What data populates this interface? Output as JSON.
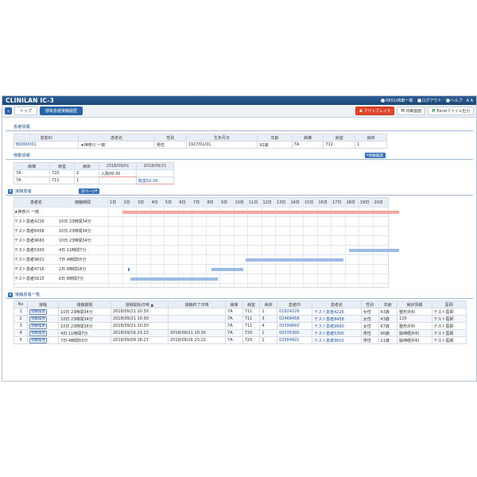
{
  "app": {
    "title": "CLINILAN IC-3"
  },
  "titlebar": {
    "items": [
      "0801/四郎一郎",
      "ログアウト",
      "ヘルプ",
      "A A"
    ]
  },
  "toolbar": {
    "crumbs": [
      "トップ",
      "感染患者接触履歴"
    ],
    "buttons": [
      "アウトブレイク",
      "印刷画面",
      "Excelファイル出力"
    ]
  },
  "patient": {
    "section": "患者情報",
    "headers": [
      "患者ID",
      "患者名",
      "性別",
      "生年月日",
      "年齢",
      "病棟",
      "病室",
      "病床"
    ],
    "row": [
      "B0000001",
      "★神奈川 一郎",
      "男性",
      "1927/01/01",
      "91歳",
      "7A",
      "711",
      "1"
    ]
  },
  "move": {
    "section": "移動情報",
    "button": "移動履歴",
    "headers": [
      "病棟",
      "病室",
      "病床",
      "2018/09/01",
      "2018/09/21"
    ],
    "rows": [
      [
        "7A",
        "720",
        "2",
        "入院09:30",
        ""
      ],
      [
        "7A",
        "711",
        "1",
        "",
        "転室10:30"
      ]
    ]
  },
  "contact": {
    "section": "接触患者",
    "page_btn": "次ページ",
    "headers": [
      "患者名",
      "接触時間"
    ],
    "days": [
      "1日",
      "2日",
      "3日",
      "4日",
      "5日",
      "6日",
      "7日",
      "8日",
      "9日",
      "10日",
      "11日",
      "12日",
      "13日",
      "14日",
      "15日",
      "16日",
      "17日",
      "18日",
      "19日",
      "20日"
    ],
    "rows": [
      {
        "name": "★神奈川 一郎",
        "dur": "",
        "start": 1,
        "end": 20.9,
        "color": "#f2a9a0"
      },
      {
        "name": "テスト患者4226",
        "dur": "10日 23時間34分",
        "start": 0,
        "end": 0,
        "color": ""
      },
      {
        "name": "テスト患者8458",
        "dur": "10日 23時間34分",
        "start": 0,
        "end": 0,
        "color": ""
      },
      {
        "name": "テスト患者9660",
        "dur": "10日 23時間34分",
        "start": 0,
        "end": 0,
        "color": ""
      },
      {
        "name": "テスト患者5300",
        "dur": "4日 11時間7分",
        "start": 17.3,
        "end": 20.9,
        "color": "#9cbbe6"
      },
      {
        "name": "テスト患者9601",
        "dur": "7日 4時間55分",
        "start": 9.9,
        "end": 16.9,
        "color": "#9cbbe6"
      },
      {
        "name": "テスト患者4716",
        "dur": "2日 8時間18分",
        "start": 7.4,
        "end": 9.7,
        "color": "#9cbbe6"
      },
      {
        "name": "テスト患者5615",
        "dur": "6日 8時間7分",
        "start": 1.6,
        "end": 7.9,
        "color": "#9cbbe6"
      }
    ],
    "marker_row": 6,
    "marker_day": 1.4
  },
  "list": {
    "section": "接触患者一覧",
    "headers": [
      "No",
      "接触",
      "接触期間",
      "接触開始日時 ▲",
      "接触終了日時",
      "病棟",
      "病室",
      "病床",
      "患者ID",
      "患者名",
      "性別",
      "年齢",
      "病状情報",
      "医師"
    ],
    "tag": "接触履歴",
    "rows": [
      [
        "1",
        "10日 23時間34分",
        "2018/09/21 10:30",
        "",
        "7A",
        "711",
        "1",
        "01824226",
        "テスト患者4226",
        "女性",
        "43歳",
        "整形外科",
        "テスト医師"
      ],
      [
        "2",
        "10日 23時間34分",
        "2018/09/21 10:30",
        "",
        "7A",
        "711",
        "3",
        "02468458",
        "テスト患者8458",
        "女性",
        "43歳",
        "120",
        "テスト医師"
      ],
      [
        "3",
        "10日 23時間34分",
        "2018/09/21 10:30",
        "",
        "7A",
        "711",
        "4",
        "00399660",
        "テスト患者9660",
        "女性",
        "67歳",
        "整形外科",
        "テスト医師"
      ],
      [
        "4",
        "4日 11時間7分",
        "2018/09/16 23:23",
        "2018/09/21 10:30",
        "7A",
        "720",
        "1",
        "00335300",
        "テスト患者5300",
        "男性",
        "90歳",
        "脳神経外科",
        "テスト医師"
      ],
      [
        "5",
        "7日 4時間55分",
        "2018/09/09 18:27",
        "2018/09/16 23:22",
        "7A",
        "720",
        "1",
        "02564601",
        "テスト患者9601",
        "男性",
        "21歳",
        "脳神経外科",
        "テスト医師"
      ]
    ]
  }
}
